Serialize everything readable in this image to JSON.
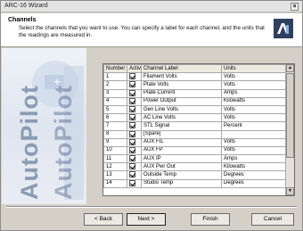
{
  "window": {
    "title": "ARC-16 Wizard",
    "close_glyph": "×"
  },
  "header": {
    "title": "Channels",
    "description": "Select the channels that you want to use. You can specify a label for each channel, and the units that the readings are measured in.",
    "logo_icon": "autopilot-logo-icon"
  },
  "sidebar": {
    "brand_text": "AutoPilot"
  },
  "table": {
    "columns": [
      "Number",
      "Activ",
      "Channel Label",
      "Units"
    ],
    "rows": [
      {
        "number": "1",
        "active": true,
        "label": "Filament Volts",
        "units": "Volts"
      },
      {
        "number": "2",
        "active": true,
        "label": "Plate Volts",
        "units": "Volts"
      },
      {
        "number": "3",
        "active": true,
        "label": "Plate Current",
        "units": "Amps"
      },
      {
        "number": "4",
        "active": true,
        "label": "Power Output",
        "units": "Kilowatts"
      },
      {
        "number": "5",
        "active": true,
        "label": "Gen Line Volts",
        "units": "Volts"
      },
      {
        "number": "6",
        "active": true,
        "label": "AC Line Volts",
        "units": "Volts"
      },
      {
        "number": "7",
        "active": true,
        "label": "STL Signal",
        "units": "Percent"
      },
      {
        "number": "8",
        "active": true,
        "label": "[Spare]",
        "units": ""
      },
      {
        "number": "9",
        "active": true,
        "label": "AUX FIL",
        "units": "Volts"
      },
      {
        "number": "10",
        "active": true,
        "label": "AUX FP",
        "units": "Volts"
      },
      {
        "number": "11",
        "active": true,
        "label": "AUX IP",
        "units": "Amps"
      },
      {
        "number": "12",
        "active": true,
        "label": "AUX Pwr Out",
        "units": "Kilowatts"
      },
      {
        "number": "13",
        "active": true,
        "label": "Outside Temp",
        "units": "Degrees"
      },
      {
        "number": "14",
        "active": true,
        "label": "Studio Temp",
        "units": "Degrees"
      }
    ]
  },
  "buttons": {
    "back": "< Back",
    "next": "Next >",
    "finish": "Finish",
    "cancel": "Cancel"
  }
}
